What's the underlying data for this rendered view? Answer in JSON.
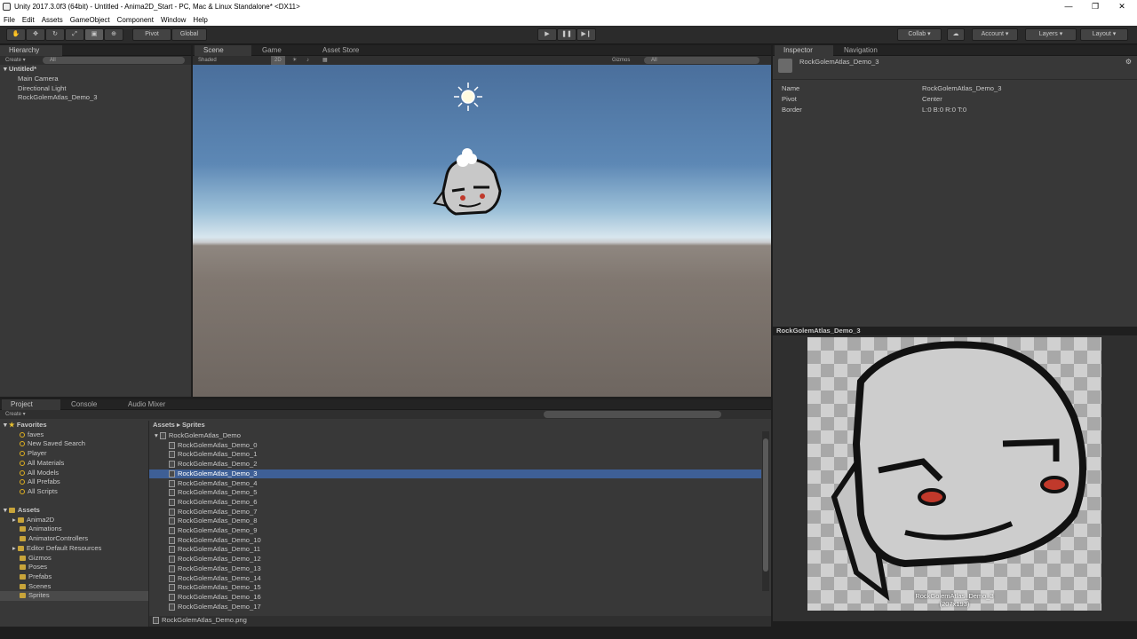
{
  "window": {
    "title": "Unity 2017.3.0f3 (64bit) - Untitled - Anima2D_Start - PC, Mac & Linux Standalone* <DX11>"
  },
  "menu": [
    "File",
    "Edit",
    "Assets",
    "GameObject",
    "Component",
    "Window",
    "Help"
  ],
  "toolbar": {
    "pivot": "Pivot",
    "global": "Global",
    "collab": "Collab",
    "account": "Account",
    "layers": "Layers",
    "layout": "Layout"
  },
  "hierarchy": {
    "tab": "Hierarchy",
    "create": "Create",
    "search_placeholder": "All",
    "scene": "Untitled*",
    "items": [
      "Main Camera",
      "Directional Light",
      "RockGolemAtlas_Demo_3"
    ]
  },
  "scene_view": {
    "tabs": [
      "Scene",
      "Game",
      "Asset Store"
    ],
    "shading": "Shaded",
    "mode_2d": "2D",
    "gizmos": "Gizmos",
    "search_placeholder": "All"
  },
  "inspector": {
    "tabs": [
      "Inspector",
      "Navigation"
    ],
    "object_name": "RockGolemAtlas_Demo_3",
    "fields": [
      {
        "label": "Name",
        "value": "RockGolemAtlas_Demo_3"
      },
      {
        "label": "Pivot",
        "value": "Center"
      },
      {
        "label": "Border",
        "value": "L:0 B:0 R:0 T:0"
      }
    ],
    "preview_title": "RockGolemAtlas_Demo_3",
    "preview_caption": "RockGolemAtlas_Demo_3",
    "preview_size": "(207x193)"
  },
  "project": {
    "tabs": [
      "Project",
      "Console",
      "Audio Mixer"
    ],
    "create": "Create",
    "favorites_label": "Favorites",
    "favorites": [
      "faves",
      "New Saved Search",
      "Player",
      "All Materials",
      "All Models",
      "All Prefabs",
      "All Scripts"
    ],
    "assets_label": "Assets",
    "folders": [
      "Anima2D",
      "Animations",
      "AnimatorControllers",
      "Editor Default Resources",
      "Gizmos",
      "Poses",
      "Prefabs",
      "Scenes",
      "Sprites"
    ],
    "selected_folder": "Sprites",
    "breadcrumb": [
      "Assets",
      "Sprites"
    ],
    "atlas": "RockGolemAtlas_Demo",
    "sprites": [
      "RockGolemAtlas_Demo_0",
      "RockGolemAtlas_Demo_1",
      "RockGolemAtlas_Demo_2",
      "RockGolemAtlas_Demo_3",
      "RockGolemAtlas_Demo_4",
      "RockGolemAtlas_Demo_5",
      "RockGolemAtlas_Demo_6",
      "RockGolemAtlas_Demo_7",
      "RockGolemAtlas_Demo_8",
      "RockGolemAtlas_Demo_9",
      "RockGolemAtlas_Demo_10",
      "RockGolemAtlas_Demo_11",
      "RockGolemAtlas_Demo_12",
      "RockGolemAtlas_Demo_13",
      "RockGolemAtlas_Demo_14",
      "RockGolemAtlas_Demo_15",
      "RockGolemAtlas_Demo_16",
      "RockGolemAtlas_Demo_17"
    ],
    "selected_sprite": "RockGolemAtlas_Demo_3",
    "footer_path": "RockGolemAtlas_Demo.png"
  },
  "colors": {
    "selection": "#3e5f96",
    "panel": "#383838",
    "toolbar": "#2b2b2b"
  }
}
